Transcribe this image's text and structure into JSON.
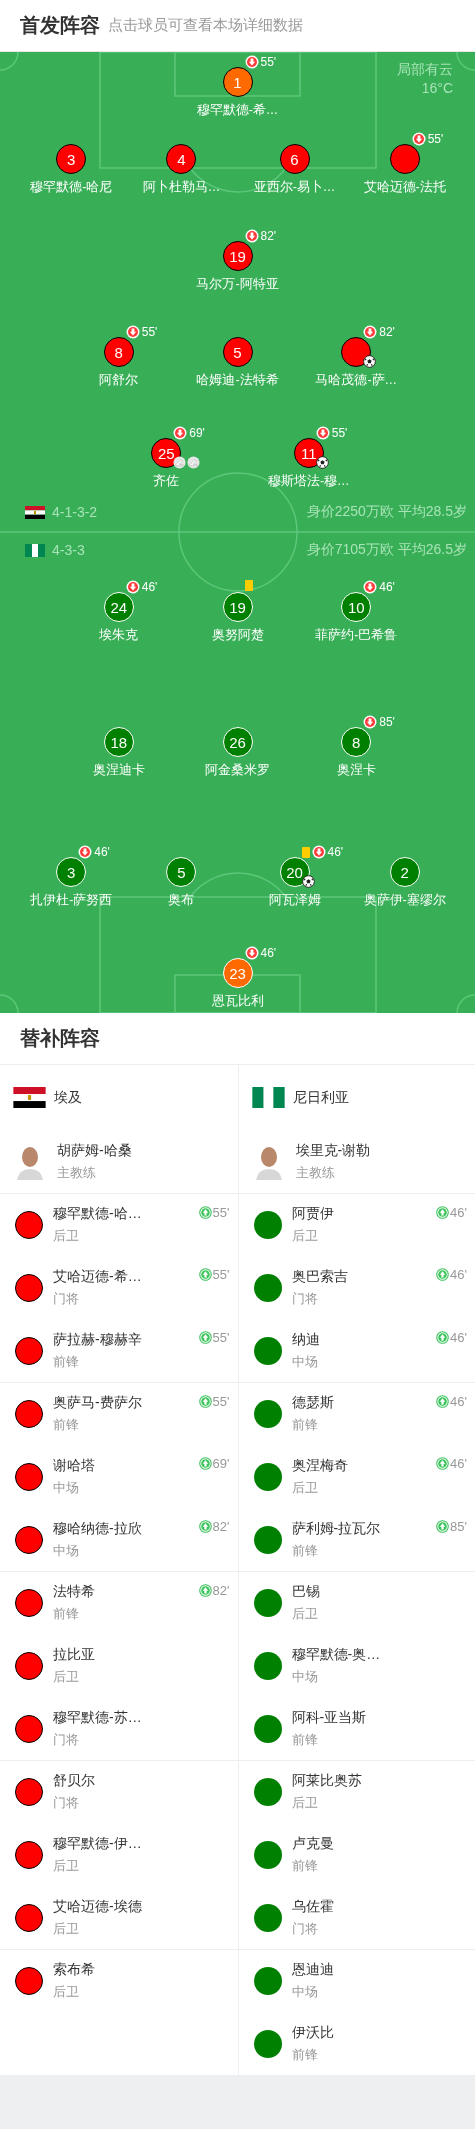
{
  "header": {
    "title": "首发阵容",
    "hint": "点击球员可查看本场详细数据"
  },
  "pitch": {
    "weather": "局部有云",
    "temperature": "16°C",
    "teams": [
      {
        "kind": "home",
        "formation": "4-1-3-2",
        "value": "身价2250万欧 平均28.5岁",
        "color": "#ff0000",
        "lines": [
          {
            "players": [
              {
                "kind": "goalkeeper",
                "number": "1",
                "name": "穆罕默德-希…",
                "sub_off": "55'"
              }
            ]
          },
          {
            "players": [
              {
                "kind": "outfield",
                "number": "3",
                "name": "穆罕默德-哈尼"
              },
              {
                "kind": "outfield",
                "number": "4",
                "name": "阿卜杜勒马…"
              },
              {
                "kind": "outfield",
                "number": "6",
                "name": "亚西尔-易卜…"
              },
              {
                "kind": "outfield",
                "name": "艾哈迈德-法托",
                "sub_off": "55'"
              }
            ]
          },
          {
            "players": [
              {
                "kind": "outfield",
                "number": "19",
                "name": "马尔万-阿特亚",
                "sub_off": "82'"
              }
            ]
          },
          {
            "players": [
              {
                "kind": "outfield",
                "number": "8",
                "name": "阿舒尔",
                "sub_off": "55'"
              },
              {
                "kind": "outfield",
                "number": "5",
                "name": "哈姆迪-法特希"
              },
              {
                "kind": "outfield",
                "name": "马哈茂德-萨…",
                "sub_off": "82'",
                "events": [
                  {
                    "kind": "goal"
                  }
                ]
              }
            ]
          },
          {
            "players": [
              {
                "kind": "outfield",
                "number": "25",
                "name": "齐佐",
                "sub_off": "69'",
                "events": [
                  {
                    "kind": "assist"
                  },
                  {
                    "kind": "assist"
                  }
                ]
              },
              {
                "kind": "outfield",
                "number": "11",
                "name": "穆斯塔法-穆…",
                "sub_off": "55'",
                "events": [
                  {
                    "kind": "goal"
                  }
                ]
              }
            ]
          }
        ]
      },
      {
        "kind": "away",
        "formation": "4-3-3",
        "value": "身价7105万欧 平均26.5岁",
        "color": "#008000",
        "lines": [
          {
            "players": [
              {
                "kind": "outfield",
                "number": "24",
                "name": "埃朱克",
                "sub_off": "46'"
              },
              {
                "kind": "outfield",
                "number": "19",
                "name": "奥努阿楚",
                "events": [
                  {
                    "kind": "yellow_card"
                  }
                ]
              },
              {
                "kind": "outfield",
                "number": "10",
                "name": "菲萨约-巴希鲁",
                "sub_off": "46'"
              }
            ]
          },
          {
            "players": [
              {
                "kind": "outfield",
                "number": "18",
                "name": "奥涅迪卡"
              },
              {
                "kind": "outfield",
                "number": "26",
                "name": "阿金桑米罗"
              },
              {
                "kind": "outfield",
                "number": "8",
                "name": "奥涅卡",
                "sub_off": "85'"
              }
            ]
          },
          {
            "players": [
              {
                "kind": "outfield",
                "number": "3",
                "name": "扎伊杜-萨努西",
                "sub_off": "46'"
              },
              {
                "kind": "outfield",
                "number": "5",
                "name": "奥布"
              },
              {
                "kind": "outfield",
                "number": "20",
                "name": "阿瓦泽姆",
                "sub_off": "46'",
                "events": [
                  {
                    "kind": "yellow_card"
                  },
                  {
                    "kind": "goal"
                  }
                ]
              },
              {
                "kind": "outfield",
                "number": "2",
                "name": "奥萨伊-塞缪尔"
              }
            ]
          },
          {
            "players": [
              {
                "kind": "goalkeeper",
                "number": "23",
                "name": "恩瓦比利",
                "sub_off": "46'"
              }
            ]
          }
        ]
      }
    ]
  },
  "substitutes": {
    "title": "替补阵容",
    "teams": [
      {
        "kind": "home",
        "name": "埃及",
        "color": "#ff0000",
        "coach": {
          "name": "胡萨姆-哈桑",
          "role": "主教练"
        },
        "players": [
          {
            "name": "穆罕默德-哈…",
            "position": "后卫",
            "sub_on": "55'"
          },
          {
            "name": "艾哈迈德-希…",
            "position": "门将",
            "sub_on": "55'"
          },
          {
            "name": "萨拉赫-穆赫辛",
            "position": "前锋",
            "sub_on": "55'"
          },
          {
            "name": "奥萨马-费萨尔",
            "position": "前锋",
            "sub_on": "55'"
          },
          {
            "name": "谢哈塔",
            "position": "中场",
            "sub_on": "69'"
          },
          {
            "name": "穆哈纳德-拉欣",
            "position": "中场",
            "sub_on": "82'"
          },
          {
            "name": "法特希",
            "position": "前锋",
            "sub_on": "82'"
          },
          {
            "name": "拉比亚",
            "position": "后卫"
          },
          {
            "name": "穆罕默德-苏…",
            "position": "门将"
          },
          {
            "name": "舒贝尔",
            "position": "门将"
          },
          {
            "name": "穆罕默德-伊…",
            "position": "后卫"
          },
          {
            "name": "艾哈迈德-埃德",
            "position": "后卫"
          },
          {
            "name": "索布希",
            "position": "后卫"
          }
        ]
      },
      {
        "kind": "away",
        "name": "尼日利亚",
        "color": "#008000",
        "coach": {
          "name": "埃里克-谢勒",
          "role": "主教练"
        },
        "players": [
          {
            "name": "阿贾伊",
            "position": "后卫",
            "sub_on": "46'"
          },
          {
            "name": "奥巴索吉",
            "position": "门将",
            "sub_on": "46'"
          },
          {
            "name": "纳迪",
            "position": "中场",
            "sub_on": "46'"
          },
          {
            "name": "德瑟斯",
            "position": "前锋",
            "sub_on": "46'"
          },
          {
            "name": "奥涅梅奇",
            "position": "后卫",
            "sub_on": "46'"
          },
          {
            "name": "萨利姆-拉瓦尔",
            "position": "前锋",
            "sub_on": "85'"
          },
          {
            "name": "巴锡",
            "position": "后卫"
          },
          {
            "name": "穆罕默德-奥…",
            "position": "中场"
          },
          {
            "name": "阿科-亚当斯",
            "position": "前锋"
          },
          {
            "name": "阿莱比奥苏",
            "position": "后卫"
          },
          {
            "name": "卢克曼",
            "position": "前锋"
          },
          {
            "name": "乌佐霍",
            "position": "门将"
          },
          {
            "name": "恩迪迪",
            "position": "中场"
          },
          {
            "name": "伊沃比",
            "position": "前锋"
          }
        ]
      }
    ]
  }
}
